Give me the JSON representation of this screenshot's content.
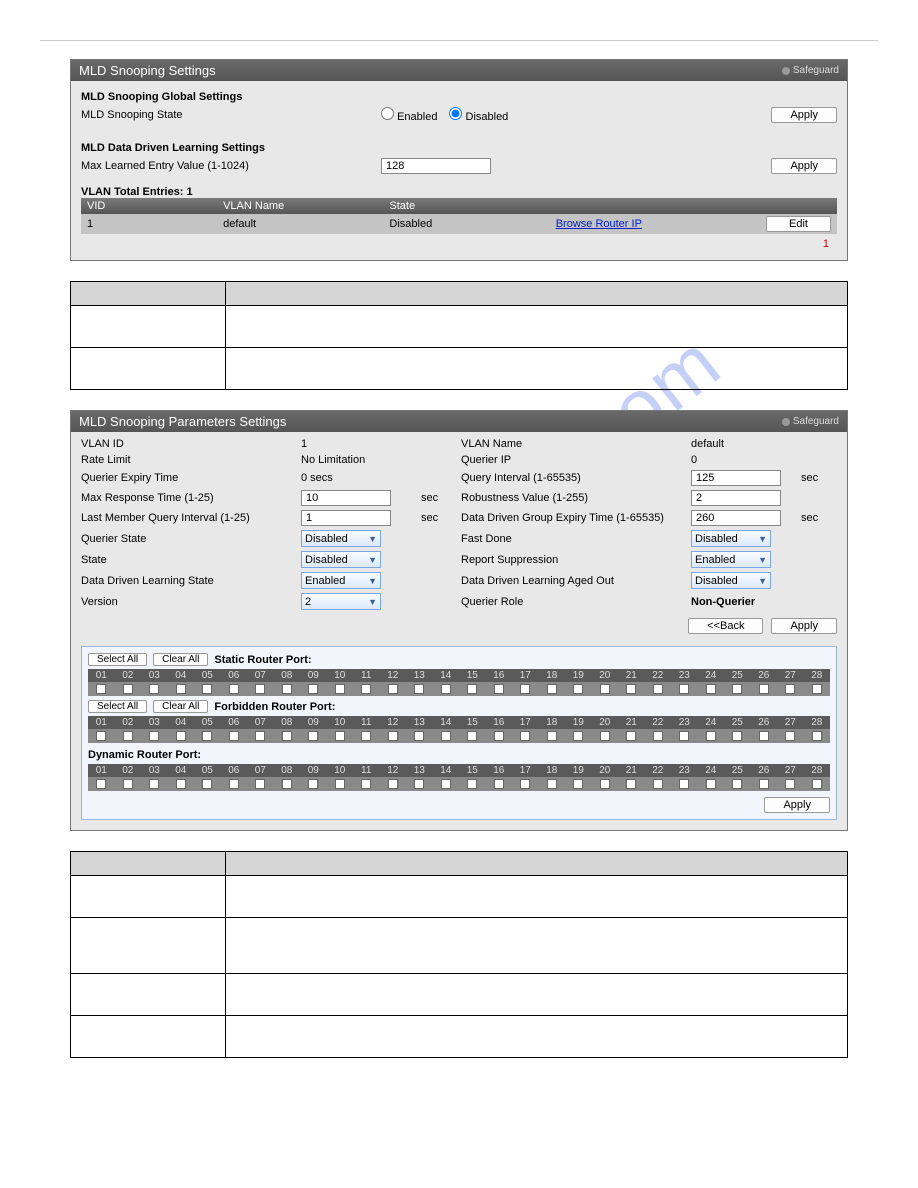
{
  "watermark": "manualshive.com",
  "panel1": {
    "title": "MLD Snooping Settings",
    "safeguard": "Safeguard",
    "globalTitle": "MLD Snooping Global Settings",
    "stateLabel": "MLD Snooping State",
    "enabledLabel": "Enabled",
    "disabledLabel": "Disabled",
    "apply": "Apply",
    "ddlTitle": "MLD Data Driven Learning Settings",
    "maxLearnedLabel": "Max Learned Entry Value (1-1024)",
    "maxLearnedValue": "128",
    "vlanTotal": "VLAN Total Entries: 1",
    "cols": {
      "vid": "VID",
      "vlanName": "VLAN Name",
      "state": "State"
    },
    "row": {
      "vid": "1",
      "vlanName": "default",
      "state": "Disabled",
      "browse": "Browse Router IP",
      "edit": "Edit"
    },
    "pageNum": "1"
  },
  "panel2": {
    "title": "MLD Snooping Parameters Settings",
    "safeguard": "Safeguard",
    "labels": {
      "vlanId": "VLAN ID",
      "rateLimit": "Rate Limit",
      "querierExpiry": "Querier Expiry Time",
      "maxResp": "Max Response Time (1-25)",
      "lastMember": "Last Member Query Interval (1-25)",
      "querierState": "Querier State",
      "state": "State",
      "ddlState": "Data Driven Learning State",
      "version": "Version",
      "vlanName": "VLAN Name",
      "querierIp": "Querier IP",
      "queryInterval": "Query Interval (1-65535)",
      "robustness": "Robustness Value (1-255)",
      "ddgExpiry": "Data Driven Group Expiry Time (1-65535)",
      "fastDone": "Fast Done",
      "reportSupp": "Report Suppression",
      "ddlAgedOut": "Data Driven Learning Aged Out",
      "querierRole": "Querier Role"
    },
    "values": {
      "vlanId": "1",
      "rateLimit": "No Limitation",
      "querierExpiry": "0 secs",
      "maxResp": "10",
      "lastMember": "1",
      "querierState": "Disabled",
      "state": "Disabled",
      "ddlState": "Enabled",
      "version": "2",
      "vlanName": "default",
      "querierIp": "0",
      "queryInterval": "125",
      "robustness": "2",
      "ddgExpiry": "260",
      "fastDone": "Disabled",
      "reportSupp": "Enabled",
      "ddlAgedOut": "Disabled",
      "querierRole": "Non-Querier"
    },
    "unitSec": "sec",
    "backBtn": "<<Back",
    "applyBtn": "Apply",
    "selectAll": "Select All",
    "clearAll": "Clear All",
    "staticLabel": "Static Router Port:",
    "forbiddenLabel": "Forbidden Router Port:",
    "dynamicLabel": "Dynamic Router Port:",
    "ports": [
      "01",
      "02",
      "03",
      "04",
      "05",
      "06",
      "07",
      "08",
      "09",
      "10",
      "11",
      "12",
      "13",
      "14",
      "15",
      "16",
      "17",
      "18",
      "19",
      "20",
      "21",
      "22",
      "23",
      "24",
      "25",
      "26",
      "27",
      "28"
    ],
    "apply": "Apply"
  }
}
